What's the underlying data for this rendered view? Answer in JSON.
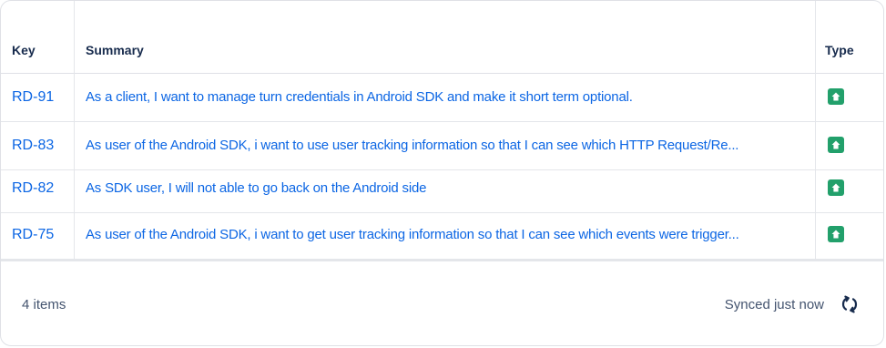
{
  "table": {
    "columns": {
      "key": "Key",
      "summary": "Summary",
      "type": "Type"
    },
    "rows": [
      {
        "key": "RD-91",
        "summary": "As a client, I want to manage turn credentials in Android SDK and make it short term optional.",
        "type_icon": "story-arrow-up-icon"
      },
      {
        "key": "RD-83",
        "summary": "As user of the Android SDK, i want to use user tracking information so that I can see which HTTP Request/Re...",
        "type_icon": "story-arrow-up-icon"
      },
      {
        "key": "RD-82",
        "summary": "As SDK user, I will not able to go back on the Android side",
        "type_icon": "story-arrow-up-icon"
      },
      {
        "key": "RD-75",
        "summary": "As user of the Android SDK, i want to get user tracking information so that I can see which events were trigger...",
        "type_icon": "story-arrow-up-icon"
      }
    ]
  },
  "footer": {
    "count": "4 items",
    "sync_status": "Synced just now",
    "refresh_icon": "refresh-icon"
  },
  "colors": {
    "link": "#0c66e4",
    "type_icon_bg": "#22a06b",
    "header_text": "#172b4d",
    "footer_text": "#44546f",
    "border": "#dfe1e6"
  }
}
